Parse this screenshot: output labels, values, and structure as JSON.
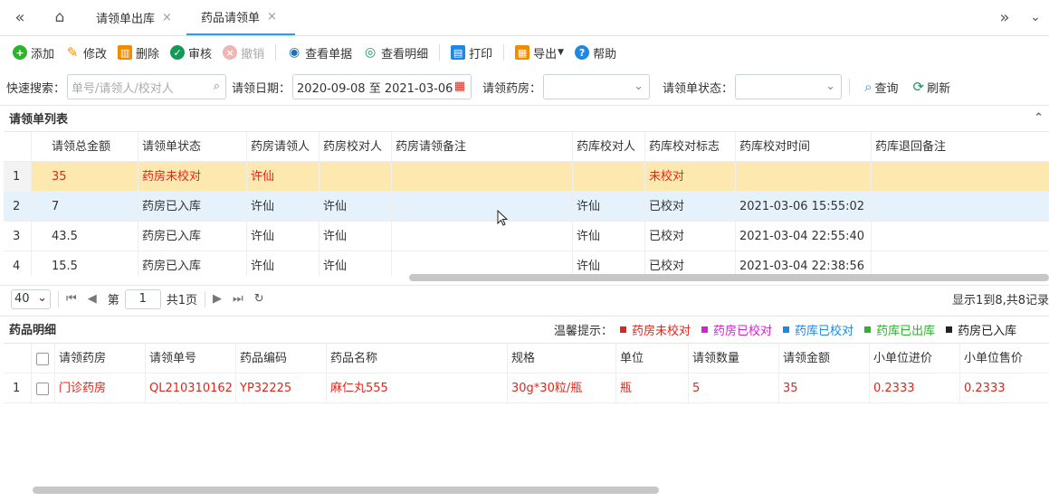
{
  "tabs": {
    "tab1": "请领单出库",
    "tab2": "药品请领单",
    "close": "×"
  },
  "toolbar": {
    "add": "添加",
    "edit": "修改",
    "delete": "删除",
    "audit": "审核",
    "revoke": "撤销",
    "view_doc": "查看单据",
    "view_detail": "查看明细",
    "print": "打印",
    "export": "导出",
    "help": "帮助"
  },
  "search": {
    "quick_label": "快速搜索：",
    "quick_placeholder": "单号/请领人/校对人",
    "date_label": "请领日期：",
    "date_value": "2020-09-08 至 2021-03-06",
    "pharmacy_label": "请领药房：",
    "status_label": "请领单状态：",
    "query": "查询",
    "refresh": "刷新"
  },
  "list": {
    "title": "请领单列表",
    "columns": [
      "请领总金额",
      "请领单状态",
      "药房请领人",
      "药房校对人",
      "药房请领备注",
      "药库校对人",
      "药库校对标志",
      "药库校对时间",
      "药库退回备注"
    ],
    "rows": [
      {
        "n": "1",
        "amount": "35",
        "status": "药房未校对",
        "requester": "许仙",
        "checker": "",
        "remark": "",
        "store_checker": "",
        "flag": "未校对",
        "time": "",
        "back": ""
      },
      {
        "n": "2",
        "amount": "7",
        "status": "药房已入库",
        "requester": "许仙",
        "checker": "许仙",
        "remark": "",
        "store_checker": "许仙",
        "flag": "已校对",
        "time": "2021-03-06 15:55:02",
        "back": ""
      },
      {
        "n": "3",
        "amount": "43.5",
        "status": "药房已入库",
        "requester": "许仙",
        "checker": "许仙",
        "remark": "",
        "store_checker": "许仙",
        "flag": "已校对",
        "time": "2021-03-04 22:55:40",
        "back": ""
      },
      {
        "n": "4",
        "amount": "15.5",
        "status": "药房已入库",
        "requester": "许仙",
        "checker": "许仙",
        "remark": "",
        "store_checker": "许仙",
        "flag": "已校对",
        "time": "2021-03-04 22:38:56",
        "back": ""
      }
    ]
  },
  "pager": {
    "page_size": "40",
    "page_label": "第",
    "page": "1",
    "total_pages": "共1页",
    "summary": "显示1到8,共8记录"
  },
  "detail": {
    "title": "药品明细",
    "hint_label": "温馨提示：",
    "legend": [
      {
        "label": "药房未校对",
        "color": "#e0261a"
      },
      {
        "label": "药房已校对",
        "color": "#d61fd6"
      },
      {
        "label": "药库已校对",
        "color": "#1e88e5"
      },
      {
        "label": "药库已出库",
        "color": "#2ab52a"
      },
      {
        "label": "药房已入库",
        "color": "#222222"
      }
    ],
    "columns": [
      "请领药房",
      "请领单号",
      "药品编码",
      "药品名称",
      "规格",
      "单位",
      "请领数量",
      "请领金额",
      "小单位进价",
      "小单位售价"
    ],
    "rows": [
      {
        "n": "1",
        "pharmacy": "门诊药房",
        "no": "QL210310162",
        "code": "YP32225",
        "name": "麻仁丸555",
        "spec": "30g*30粒/瓶",
        "unit": "瓶",
        "qty": "5",
        "amount": "35",
        "cost": "0.2333",
        "price": "0.2333"
      }
    ]
  }
}
